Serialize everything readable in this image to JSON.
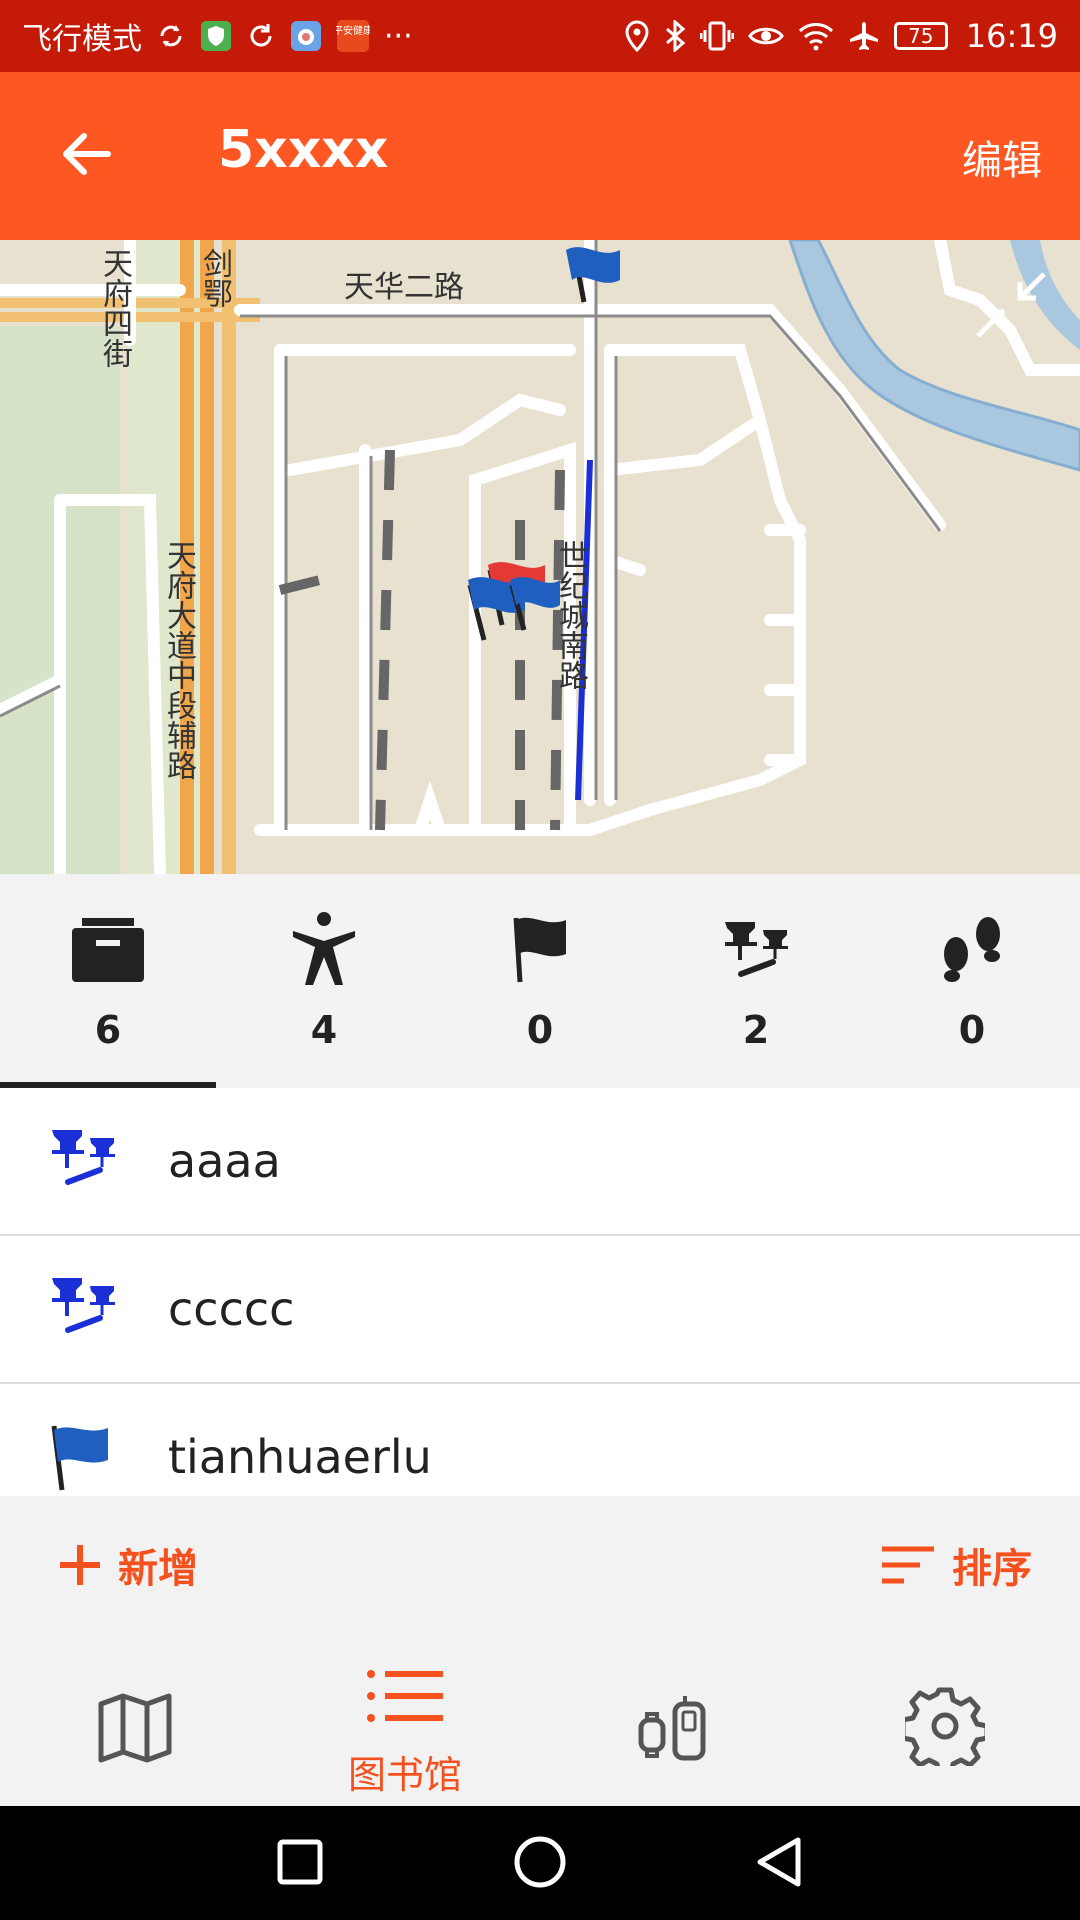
{
  "status_bar": {
    "airplane_mode_text": "飞行模式",
    "battery_level": "75",
    "time": "16:19",
    "more": "···",
    "app_badge_text": "平安健康"
  },
  "app_bar": {
    "title": "5xxxx",
    "edit_label": "编辑"
  },
  "map": {
    "labels": {
      "tianhua_erlu": "天华二路",
      "tianfu_sijie": "天府四街",
      "tianfu_dadao": "天府大道中段辅路",
      "shiji_cheng": "世纪城南路",
      "ejiang": "剑鄂"
    }
  },
  "stats": [
    {
      "icon": "briefcase-icon",
      "count": "6"
    },
    {
      "icon": "person-icon",
      "count": "4"
    },
    {
      "icon": "flag-icon",
      "count": "0"
    },
    {
      "icon": "route-icon",
      "count": "2"
    },
    {
      "icon": "footsteps-icon",
      "count": "0"
    }
  ],
  "list": [
    {
      "icon": "route-icon",
      "label": "aaaa"
    },
    {
      "icon": "route-icon",
      "label": "ccccc"
    },
    {
      "icon": "flag-icon",
      "label": "tianhuaerlu"
    }
  ],
  "actions": {
    "add_label": "新增",
    "sort_label": "排序"
  },
  "bottom_nav": {
    "library_label": "图书馆"
  },
  "colors": {
    "status_bar": "#c51a08",
    "app_bar": "#ff5722",
    "accent": "#f4511e",
    "route_blue": "#1a2fd6"
  }
}
